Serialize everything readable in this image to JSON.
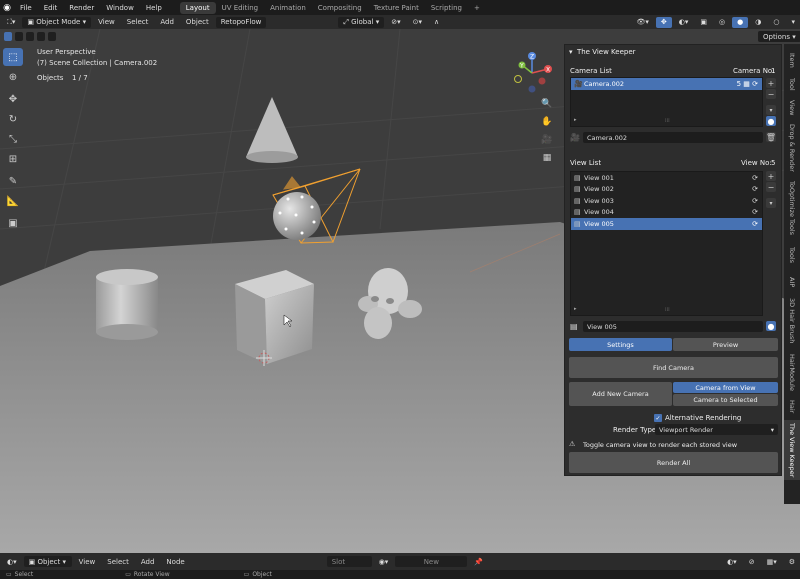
{
  "topbar": {
    "menus": [
      "File",
      "Edit",
      "Render",
      "Window",
      "Help"
    ],
    "tabs": [
      {
        "label": "Layout",
        "active": true
      },
      {
        "label": "UV Editing",
        "active": false
      },
      {
        "label": "Animation",
        "active": false
      },
      {
        "label": "Compositing",
        "active": false
      },
      {
        "label": "Texture Paint",
        "active": false
      },
      {
        "label": "Scripting",
        "active": false
      }
    ],
    "add_tab": "+"
  },
  "header": {
    "mode": "Object Mode",
    "menus": [
      "View",
      "Select",
      "Add",
      "Object",
      "RetopoFlow"
    ],
    "orientation": "Global",
    "options": "Options"
  },
  "viewport": {
    "perspective": "User Perspective",
    "collection": "(7) Scene Collection | Camera.002",
    "objects_label": "Objects",
    "objects_count": "1 / 7",
    "gizmo_x": "X",
    "gizmo_y": "Y",
    "gizmo_z": "Z"
  },
  "panel": {
    "title": "The View Keeper",
    "camera_list_label": "Camera List",
    "camera_no_label": "Camera No:",
    "camera_no": "1",
    "camera_items": [
      {
        "name": "Camera.002",
        "count": "5",
        "selected": true
      }
    ],
    "camera_name_field": "Camera.002",
    "view_list_label": "View List",
    "view_no_label": "View No:",
    "view_no": "5",
    "view_items": [
      {
        "name": "View 001",
        "selected": false
      },
      {
        "name": "View 002",
        "selected": false
      },
      {
        "name": "View 003",
        "selected": false
      },
      {
        "name": "View 004",
        "selected": false
      },
      {
        "name": "View 005",
        "selected": true
      }
    ],
    "view_name_field": "View 005",
    "tab_settings": "Settings",
    "tab_preview": "Preview",
    "find_camera": "Find Camera",
    "add_new_camera": "Add New Camera",
    "camera_from_view": "Camera from View",
    "camera_to_selected": "Camera to Selected",
    "alt_rendering": "Alternative Rendering",
    "render_type_label": "Render Type",
    "render_type_value": "Viewport Render",
    "hint": "Toggle camera view to render each stored view",
    "render_all": "Render All"
  },
  "sidetabs": [
    "Item",
    "Tool",
    "View",
    "Drop & Render",
    "ToOptimize Tools",
    "Tools",
    "AIP",
    "3D Hair Brush",
    "HairModule",
    "Hair",
    "The View Keeper"
  ],
  "bottom": {
    "mode": "Object",
    "menus": [
      "View",
      "Select",
      "Add",
      "Node"
    ],
    "slot": "Slot",
    "new": "New",
    "status_select": "Select",
    "status_rotate": "Rotate View",
    "status_object": "Object"
  },
  "colors": {
    "accent": "#4772b3",
    "selection_orange": "#f0a030",
    "viewport_bg": "#3d3d3d"
  }
}
